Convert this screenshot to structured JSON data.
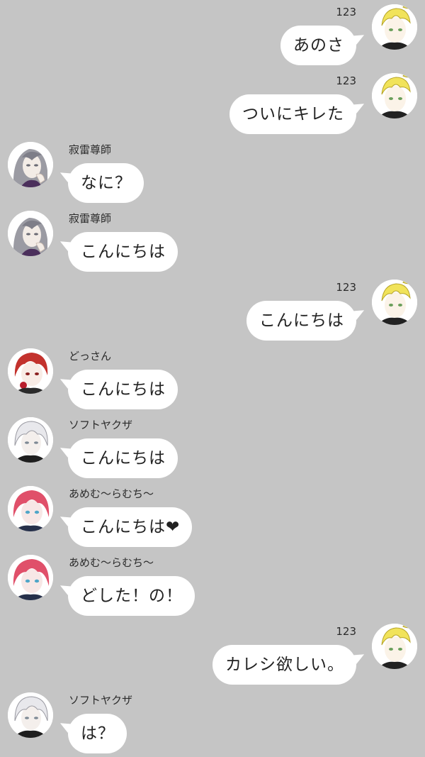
{
  "messages": [
    {
      "side": "right",
      "sender": "123",
      "avatar": "blond-character-avatar",
      "text": "あのさ"
    },
    {
      "side": "right",
      "sender": "123",
      "avatar": "blond-character-avatar",
      "text": "ついにキレた"
    },
    {
      "side": "left",
      "sender": "寂雷尊師",
      "avatar": "silver-long-hair-character-avatar",
      "text": "なに？"
    },
    {
      "side": "left",
      "sender": "寂雷尊師",
      "avatar": "silver-long-hair-character-avatar",
      "text": "こんにちは"
    },
    {
      "side": "right",
      "sender": "123",
      "avatar": "blond-character-avatar",
      "text": "こんにちは"
    },
    {
      "side": "left",
      "sender": "どっさん",
      "avatar": "red-hair-character-avatar",
      "text": "こんにちは"
    },
    {
      "side": "left",
      "sender": "ソフトヤクザ",
      "avatar": "white-hair-character-avatar",
      "text": "こんにちは"
    },
    {
      "side": "left",
      "sender": "あめむ〜らむち〜",
      "avatar": "pink-hair-character-avatar",
      "text": "こんにちは❤"
    },
    {
      "side": "left",
      "sender": "あめむ〜らむち〜",
      "avatar": "pink-hair-character-avatar",
      "text": "どした！の！"
    },
    {
      "side": "right",
      "sender": "123",
      "avatar": "blond-character-avatar",
      "text": "カレシ欲しい。"
    },
    {
      "side": "left",
      "sender": "ソフトヤクザ",
      "avatar": "white-hair-character-avatar",
      "text": "は？"
    }
  ],
  "colors": {
    "background": "#c5c5c5",
    "bubble": "#ffffff",
    "text": "#222222",
    "blond_hair": "#f1e35a",
    "silver_hair": "#9b9ba3",
    "red_hair": "#c3322d",
    "white_hair": "#e8e8ec",
    "pink_hair": "#e0506a"
  }
}
